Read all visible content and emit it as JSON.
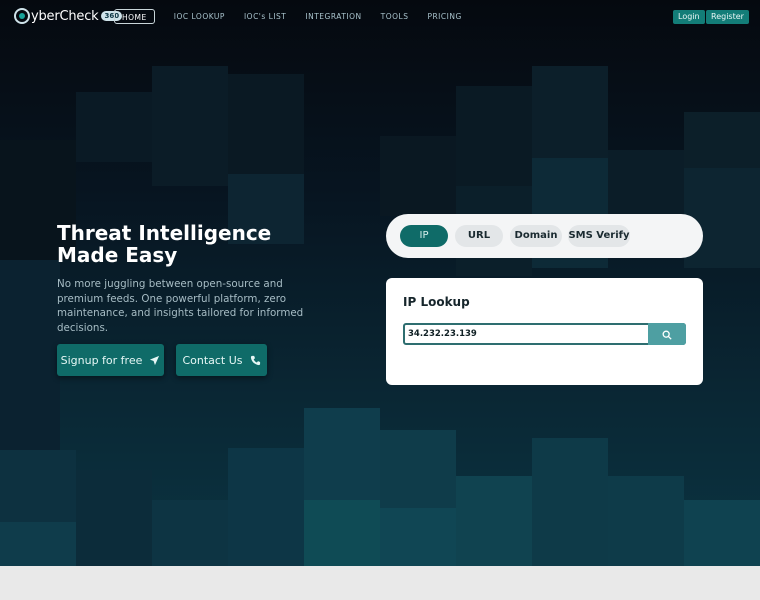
{
  "nav": {
    "logo_text": "yberCheck",
    "logo_badge": "360",
    "links": [
      "HOME",
      "IOC LOOKUP",
      "IOC's LIST",
      "INTEGRATION",
      "TOOLS",
      "PRICING"
    ],
    "login": "Login",
    "register": "Register"
  },
  "hero": {
    "headline_line1": "Threat Intelligence",
    "headline_line2": "Made Easy",
    "subcopy": "No more juggling between open-source and premium feeds. One powerful platform, zero maintenance, and insights tailored for informed decisions.",
    "signup_label": "Signup for free",
    "contact_label": "Contact Us"
  },
  "lookup": {
    "tabs": [
      "IP",
      "URL",
      "Domain",
      "SMS Verify"
    ],
    "active_tab": "IP",
    "card_title": "IP Lookup",
    "input_value": "34.232.23.139"
  },
  "colors": {
    "accent": "#0f6b68",
    "search_button": "#4e9fa2",
    "hero_dark": "#05090f",
    "hero_bottom": "#0b3442"
  }
}
